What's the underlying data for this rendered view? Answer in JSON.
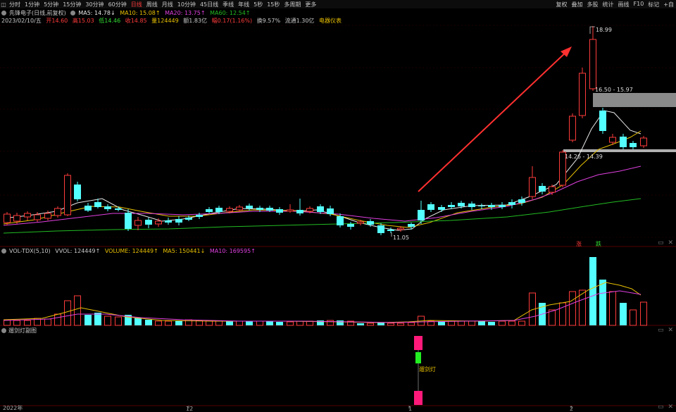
{
  "toolbar": {
    "items": [
      "分时",
      "1分钟",
      "5分钟",
      "15分钟",
      "30分钟",
      "60分钟",
      "日线",
      "周线",
      "月线",
      "10分钟",
      "45日线",
      "季线",
      "年线",
      "5秒",
      "15秒",
      "多周期",
      "更多"
    ],
    "active_index": 6,
    "right_items": [
      "复权",
      "叠加",
      "多股",
      "统计",
      "画线",
      "F10",
      "标记",
      "+自"
    ]
  },
  "stock": {
    "name": "先锋电子(日线,前复权)",
    "ma5": "MA5: 14.78↓",
    "ma10": "MA10: 15.08↑",
    "ma20": "MA20: 13.75↑",
    "ma60": "MA60: 12.54↑"
  },
  "bar_info": {
    "date": "2023/02/10/五",
    "open": "开14.60",
    "high": "高15.03",
    "low": "低14.46",
    "close": "收14.85",
    "volume": "量124449",
    "amount": "额1.83亿",
    "change": "幅0.17(1.16%)",
    "turnover": "换9.57%",
    "float_cap": "流通1.30亿",
    "sector": "电器仪表"
  },
  "annotations": {
    "high_price": "18.99",
    "low_price": "11.05",
    "zone_upper": "16.50 - 15.97",
    "zone_lower": "14.26 - 14.39",
    "tag_rise": "涨",
    "tag_fall": "跌",
    "signal_label": "遛剑灯"
  },
  "volume": {
    "title": "VOL-TDX(5,10)",
    "vvol": "VVOL: 124449↑",
    "volume": "VOLUME: 124449↑",
    "ma5": "MA5: 150441↓",
    "ma10": "MA10: 169595↑"
  },
  "indicator": {
    "title": "遛剑灯副图"
  },
  "x_axis": {
    "labels": [
      "2022年",
      "12",
      "1",
      "2"
    ]
  },
  "colors": {
    "up": "#ff3b3b",
    "down": "#54ffff",
    "ma5": "#e8e8e8",
    "ma10": "#e8c000",
    "ma20": "#e040e0",
    "ma60": "#22bb22",
    "signal_pink": "#ff1a7a",
    "signal_green": "#22ee22"
  }
}
